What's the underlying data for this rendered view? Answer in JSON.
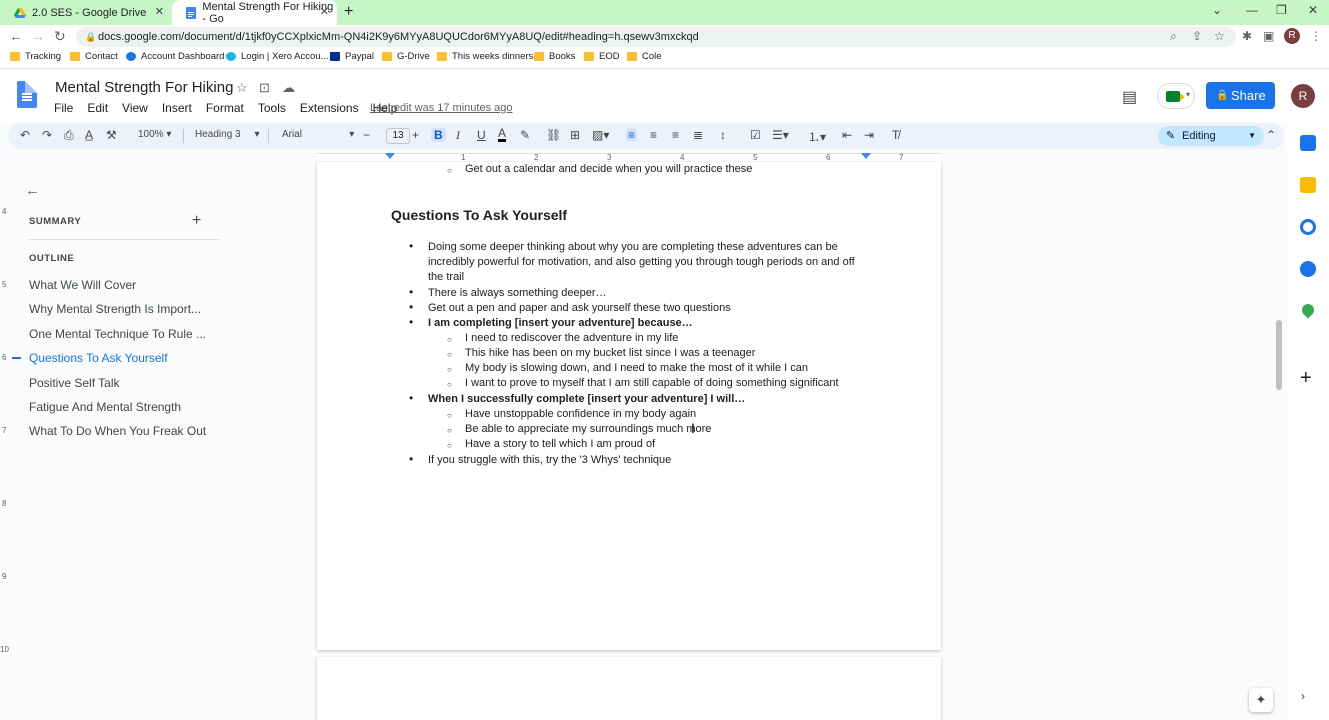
{
  "browser": {
    "tabs": [
      {
        "title": "2.0 SES - Google Drive"
      },
      {
        "title": "Mental Strength For Hiking - Go"
      }
    ],
    "url": "docs.google.com/document/d/1tjkf0yCCXplxicMm-QN4i2K9y6MYyA8UQUCdor6MYyA8UQ/edit#heading=h.qsewv3mxckqd",
    "profile_initial": "R",
    "bookmarks": [
      "Tracking",
      "Contact",
      "Account Dashboard",
      "Login | Xero Accou...",
      "Paypal",
      "G-Drive",
      "This weeks dinners",
      "Books",
      "EOD",
      "Cole"
    ]
  },
  "doc": {
    "title": "Mental Strength For Hiking",
    "menus": [
      "File",
      "Edit",
      "View",
      "Insert",
      "Format",
      "Tools",
      "Extensions",
      "Help"
    ],
    "last_edit": "Last edit was 17 minutes ago",
    "share_label": "Share",
    "avatar_initial": "R"
  },
  "toolbar": {
    "zoom": "100%",
    "style": "Heading 3",
    "font": "Arial",
    "font_size": "13",
    "mode": "Editing"
  },
  "ruler": {
    "numbers": [
      "1",
      "2",
      "3",
      "4",
      "5",
      "6",
      "7"
    ],
    "vertical_numbers": [
      "4",
      "5",
      "6",
      "7",
      "8",
      "9",
      "10"
    ]
  },
  "sidebar": {
    "summary_label": "SUMMARY",
    "outline_label": "OUTLINE",
    "items": [
      {
        "label": "What We Will Cover",
        "active": false
      },
      {
        "label": "Why Mental Strength Is Import...",
        "active": false
      },
      {
        "label": "One Mental Technique To Rule ...",
        "active": false
      },
      {
        "label": "Questions To Ask Yourself",
        "active": true
      },
      {
        "label": "Positive Self Talk",
        "active": false
      },
      {
        "label": "Fatigue And Mental Strength",
        "active": false
      },
      {
        "label": "What To Do When You Freak Out",
        "active": false
      }
    ]
  },
  "content": {
    "top_line": "Get out a calendar and decide when you will practice these",
    "heading": "Questions To Ask Yourself",
    "lines": [
      {
        "level": 1,
        "text": "Doing some deeper thinking about why you are completing these adventures can be",
        "bold": false,
        "bullet": true
      },
      {
        "level": 1,
        "text": "incredibly powerful for motivation, and also getting you through tough periods on and off",
        "bold": false,
        "bullet": false
      },
      {
        "level": 1,
        "text": "the trail",
        "bold": false,
        "bullet": false
      },
      {
        "level": 1,
        "text": "There is always something deeper…",
        "bold": false,
        "bullet": true
      },
      {
        "level": 1,
        "text": "Get out a pen and paper and ask yourself these two questions",
        "bold": false,
        "bullet": true
      },
      {
        "level": 1,
        "text": " I am completing [insert your adventure] because…",
        "bold": true,
        "bullet": true
      },
      {
        "level": 2,
        "text": "I need to rediscover the adventure in my life",
        "bold": false,
        "bullet": true
      },
      {
        "level": 2,
        "text": "This hike has been on my bucket list since I was a teenager",
        "bold": false,
        "bullet": true
      },
      {
        "level": 2,
        "text": "My body is slowing down, and I need to make the most of it while I can",
        "bold": false,
        "bullet": true
      },
      {
        "level": 2,
        "text": "I want to prove to myself that I am still capable of doing something significant",
        "bold": false,
        "bullet": true
      },
      {
        "level": 1,
        "text": "When I successfully complete [insert your adventure] I will…",
        "bold": true,
        "bullet": true
      },
      {
        "level": 2,
        "text": "Have unstoppable confidence in my body again",
        "bold": false,
        "bullet": true
      },
      {
        "level": 2,
        "text": "Be able to appreciate my surroundings much more",
        "bold": false,
        "bullet": true
      },
      {
        "level": 2,
        "text": "Have a story to tell which I am proud of",
        "bold": false,
        "bullet": true
      },
      {
        "level": 1,
        "text": "If you struggle with this, try the '3 Whys' technique",
        "bold": false,
        "bullet": true
      }
    ]
  },
  "colors": {
    "accent": "#1a73e8",
    "tab_strip": "#c6f5c6"
  }
}
